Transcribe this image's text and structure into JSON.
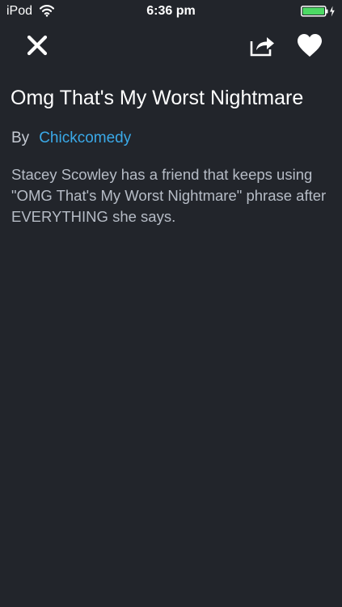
{
  "status_bar": {
    "carrier": "iPod",
    "time": "6:36 pm",
    "battery_color": "#4cd964"
  },
  "toolbar": {
    "close_icon": "close-icon",
    "share_icon": "share-icon",
    "favorite_icon": "heart-icon"
  },
  "article": {
    "title": "Omg That's My Worst Nightmare",
    "by_label": "By",
    "author": "Chickcomedy",
    "description": "Stacey Scowley has a friend that keeps using \"OMG That's My Worst Nightmare\" phrase after EVERYTHING she says."
  },
  "colors": {
    "background": "#22252b",
    "link": "#3aa9e8",
    "text_muted": "#b6bcc6"
  }
}
